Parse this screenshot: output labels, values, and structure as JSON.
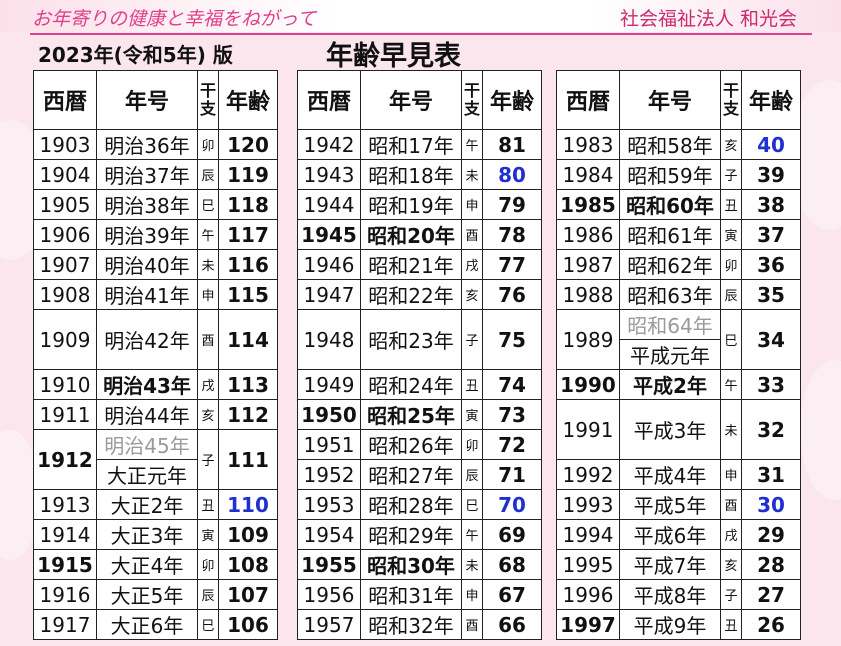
{
  "header": {
    "tagline": "お年寄りの健康と幸福をねがって",
    "org": "社会福祉法人 和光会",
    "year_label": "2023年(令和5年) 版",
    "title": "年齢早見表"
  },
  "columns": {
    "year": "西暦",
    "era": "年号",
    "zodiac_top": "干",
    "zodiac_bottom": "支",
    "age": "年齢"
  },
  "col1": [
    {
      "year": "1903",
      "era": "明治36年",
      "z": "卯",
      "age": "120"
    },
    {
      "year": "1904",
      "era": "明治37年",
      "z": "辰",
      "age": "119"
    },
    {
      "year": "1905",
      "era": "明治38年",
      "z": "巳",
      "age": "118"
    },
    {
      "year": "1906",
      "era": "明治39年",
      "z": "午",
      "age": "117"
    },
    {
      "year": "1907",
      "era": "明治40年",
      "z": "未",
      "age": "116"
    },
    {
      "year": "1908",
      "era": "明治41年",
      "z": "申",
      "age": "115"
    },
    {
      "year": "1909",
      "era": "明治42年",
      "z": "酉",
      "age": "114"
    },
    {
      "year": "1910",
      "era": "明治43年",
      "z": "戌",
      "age": "113"
    },
    {
      "year": "1911",
      "era": "明治44年",
      "z": "亥",
      "age": "112"
    },
    {
      "year": "1912",
      "era": "明治45年",
      "era2": "大正元年",
      "z": "子",
      "age": "111"
    },
    {
      "year": "1913",
      "era": "大正2年",
      "z": "丑",
      "age": "110"
    },
    {
      "year": "1914",
      "era": "大正3年",
      "z": "寅",
      "age": "109"
    },
    {
      "year": "1915",
      "era": "大正4年",
      "z": "卯",
      "age": "108"
    },
    {
      "year": "1916",
      "era": "大正5年",
      "z": "辰",
      "age": "107"
    },
    {
      "year": "1917",
      "era": "大正6年",
      "z": "巳",
      "age": "106"
    }
  ],
  "col2": [
    {
      "year": "1942",
      "era": "昭和17年",
      "z": "午",
      "age": "81"
    },
    {
      "year": "1943",
      "era": "昭和18年",
      "z": "未",
      "age": "80"
    },
    {
      "year": "1944",
      "era": "昭和19年",
      "z": "申",
      "age": "79"
    },
    {
      "year": "1945",
      "era": "昭和20年",
      "z": "酉",
      "age": "78"
    },
    {
      "year": "1946",
      "era": "昭和21年",
      "z": "戌",
      "age": "77"
    },
    {
      "year": "1947",
      "era": "昭和22年",
      "z": "亥",
      "age": "76"
    },
    {
      "year": "1948",
      "era": "昭和23年",
      "z": "子",
      "age": "75"
    },
    {
      "year": "1949",
      "era": "昭和24年",
      "z": "丑",
      "age": "74"
    },
    {
      "year": "1950",
      "era": "昭和25年",
      "z": "寅",
      "age": "73"
    },
    {
      "year": "1951",
      "era": "昭和26年",
      "z": "卯",
      "age": "72"
    },
    {
      "year": "1952",
      "era": "昭和27年",
      "z": "辰",
      "age": "71"
    },
    {
      "year": "1953",
      "era": "昭和28年",
      "z": "巳",
      "age": "70"
    },
    {
      "year": "1954",
      "era": "昭和29年",
      "z": "午",
      "age": "69"
    },
    {
      "year": "1955",
      "era": "昭和30年",
      "z": "未",
      "age": "68"
    },
    {
      "year": "1956",
      "era": "昭和31年",
      "z": "申",
      "age": "67"
    },
    {
      "year": "1957",
      "era": "昭和32年",
      "z": "酉",
      "age": "66"
    }
  ],
  "col3": [
    {
      "year": "1983",
      "era": "昭和58年",
      "z": "亥",
      "age": "40"
    },
    {
      "year": "1984",
      "era": "昭和59年",
      "z": "子",
      "age": "39"
    },
    {
      "year": "1985",
      "era": "昭和60年",
      "z": "丑",
      "age": "38"
    },
    {
      "year": "1986",
      "era": "昭和61年",
      "z": "寅",
      "age": "37"
    },
    {
      "year": "1987",
      "era": "昭和62年",
      "z": "卯",
      "age": "36"
    },
    {
      "year": "1988",
      "era": "昭和63年",
      "z": "辰",
      "age": "35"
    },
    {
      "year": "1989",
      "era": "昭和64年",
      "era2": "平成元年",
      "z": "巳",
      "age": "34"
    },
    {
      "year": "1990",
      "era": "平成2年",
      "z": "午",
      "age": "33"
    },
    {
      "year": "1991",
      "era": "平成3年",
      "z": "未",
      "age": "32"
    },
    {
      "year": "1992",
      "era": "平成4年",
      "z": "申",
      "age": "31"
    },
    {
      "year": "1993",
      "era": "平成5年",
      "z": "酉",
      "age": "30"
    },
    {
      "year": "1994",
      "era": "平成6年",
      "z": "戌",
      "age": "29"
    },
    {
      "year": "1995",
      "era": "平成7年",
      "z": "亥",
      "age": "28"
    },
    {
      "year": "1996",
      "era": "平成8年",
      "z": "子",
      "age": "27"
    },
    {
      "year": "1997",
      "era": "平成9年",
      "z": "丑",
      "age": "26"
    }
  ],
  "colors": {
    "accent": "#e0408a",
    "blue_age": "#2030d0",
    "obsolete_era": "#9a9a9a"
  }
}
